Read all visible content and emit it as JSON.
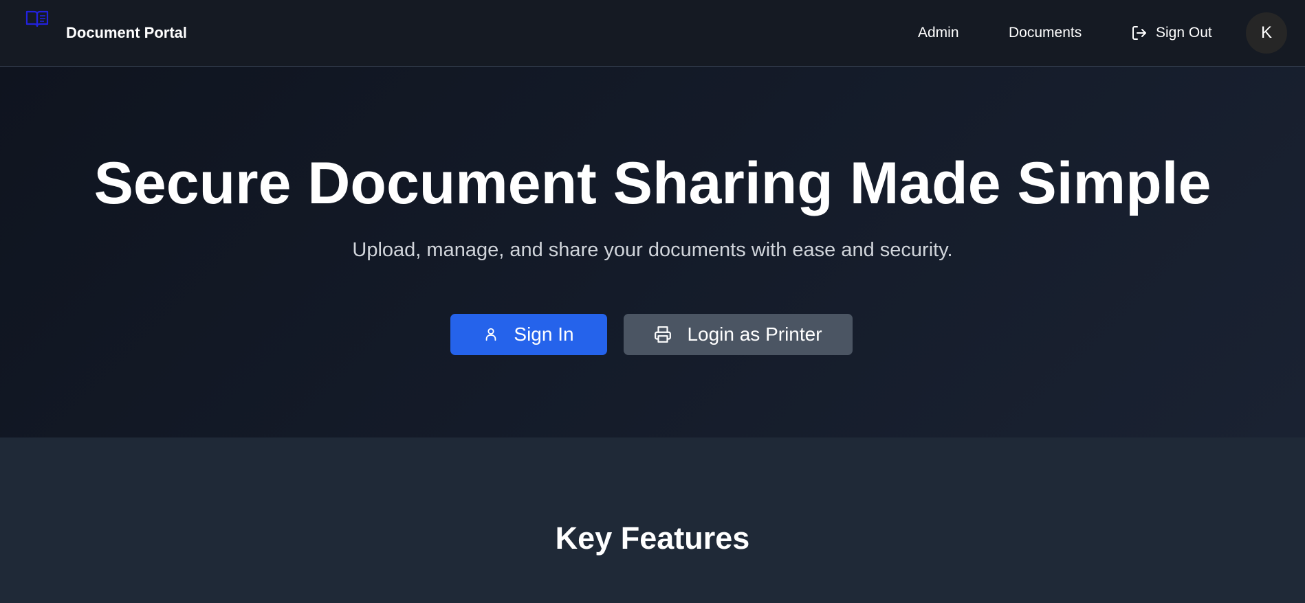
{
  "header": {
    "brand_name": "Document Portal",
    "brand_icon": "book-open-document-icon",
    "brand_color": "#2563eb",
    "nav": {
      "admin_label": "Admin",
      "documents_label": "Documents",
      "signout_label": "Sign Out",
      "signout_icon": "log-out-icon"
    },
    "avatar_initial": "K"
  },
  "hero": {
    "title": "Secure Document Sharing Made Simple",
    "subtitle": "Upload, manage, and share your documents with ease and security.",
    "signin_button": {
      "label": "Sign In",
      "icon": "user-icon",
      "color": "#2563eb"
    },
    "printer_button": {
      "label": "Login as Printer",
      "icon": "printer-icon",
      "color": "#4b5563"
    }
  },
  "features": {
    "title": "Key Features"
  }
}
